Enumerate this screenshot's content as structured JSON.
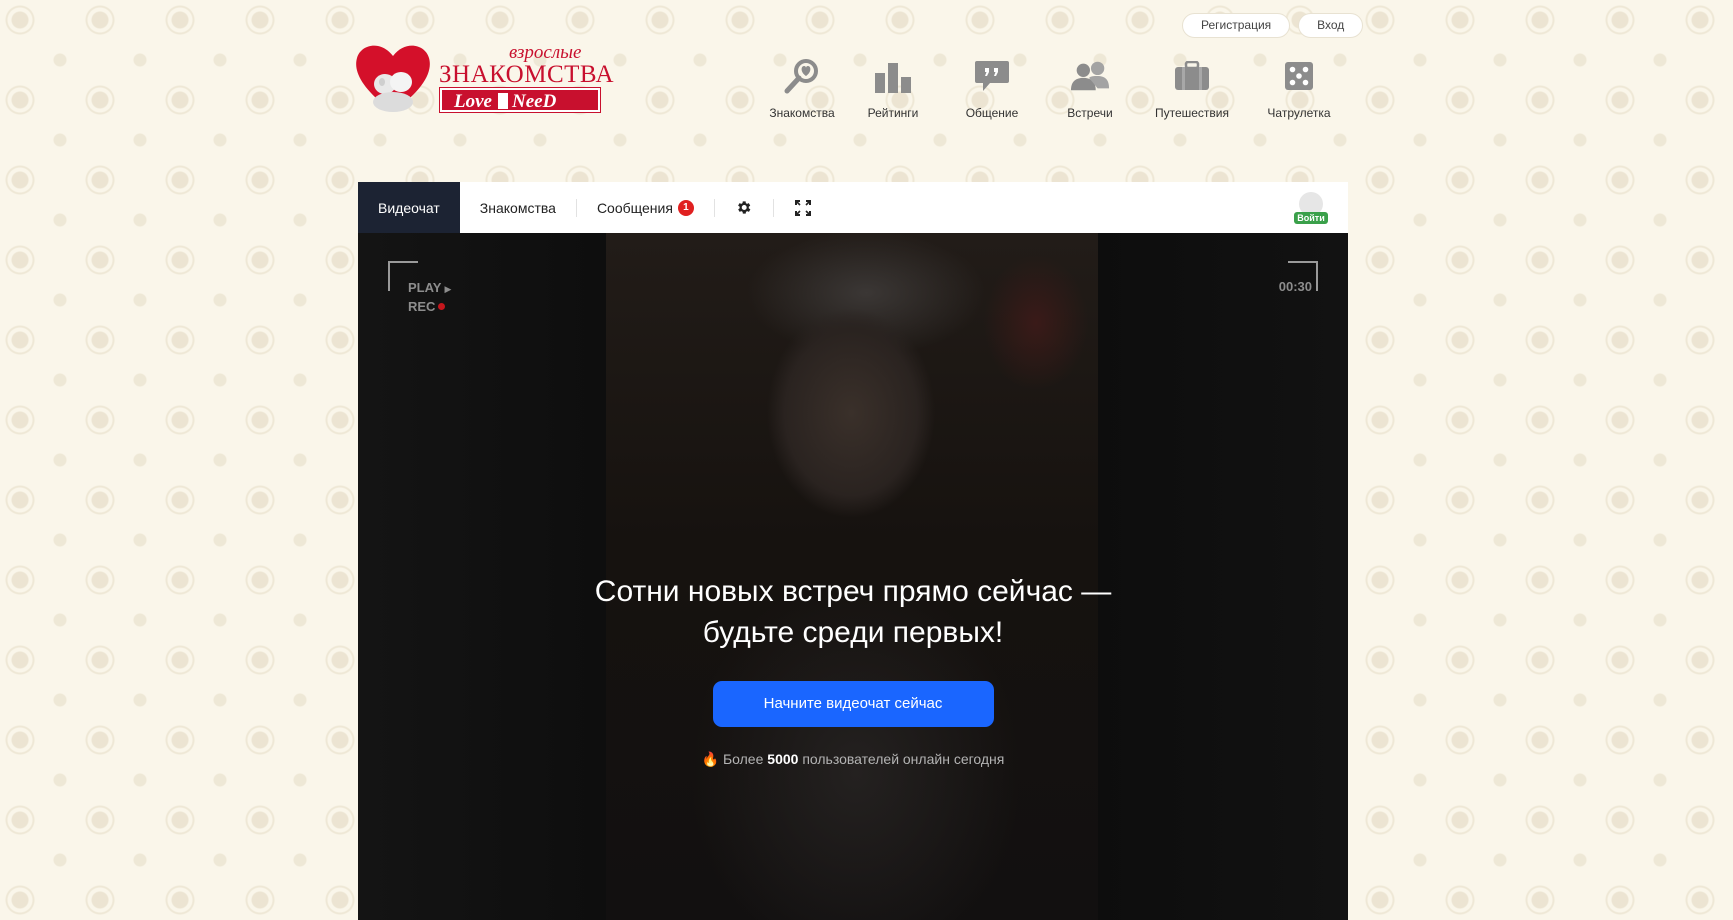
{
  "header": {
    "auth": {
      "register_label": "Регистрация",
      "login_label": "Вход"
    },
    "logo": {
      "line1": "взрослые",
      "line2": "ЗНАКОМСТВА",
      "line3_left": "Love",
      "line3_right": "NeeD"
    },
    "nav": [
      {
        "label": "Знакомства",
        "icon": "search-heart-icon"
      },
      {
        "label": "Рейтинги",
        "icon": "bar-chart-icon"
      },
      {
        "label": "Общение",
        "icon": "chat-bubble-icon"
      },
      {
        "label": "Встречи",
        "icon": "people-icon"
      },
      {
        "label": "Путешествия",
        "icon": "suitcase-icon"
      },
      {
        "label": "Чатрулетка",
        "icon": "dice-icon"
      }
    ]
  },
  "chat": {
    "tabs": {
      "videochat": "Видеочат",
      "dating": "Знакомства",
      "messages": "Сообщения",
      "messages_count": "1"
    },
    "login_badge": "Войти",
    "overlay": {
      "play": "PLAY",
      "rec": "REC",
      "timer": "00:30"
    },
    "headline": "Сотни новых встреч прямо сейчас — будьте среди первых!",
    "cta_label": "Начните видеочат сейчас",
    "online": {
      "prefix": "Более",
      "count": "5000",
      "suffix": "пользователей онлайн сегодня"
    }
  },
  "colors": {
    "brand_red": "#c8102e",
    "cta_blue": "#1a66ff",
    "active_tab": "#1c2333",
    "icon_gray": "#8c8c8c"
  }
}
